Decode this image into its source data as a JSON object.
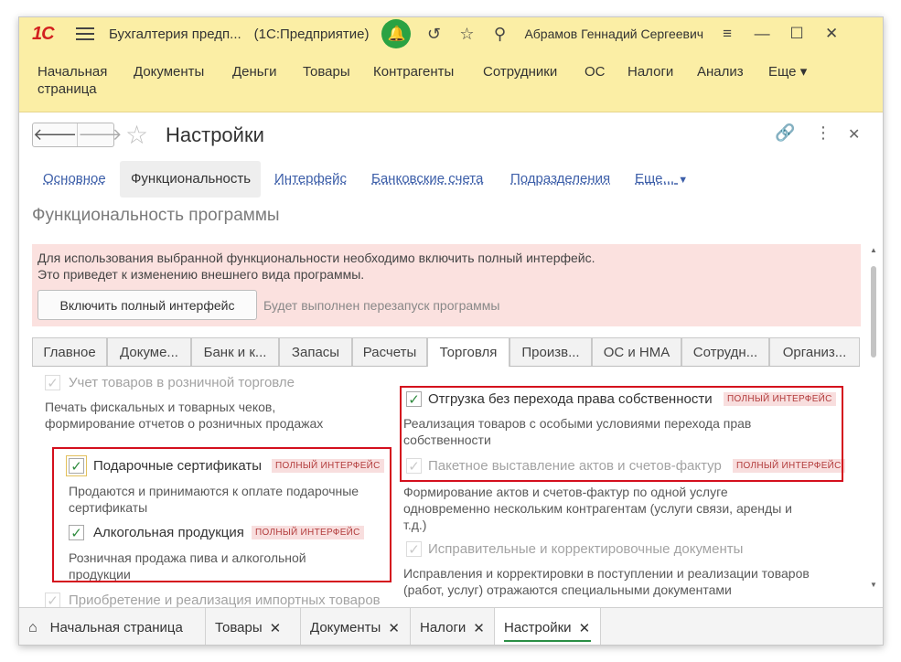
{
  "titlebar": {
    "logo": "1С",
    "app_name": "Бухгалтерия предп...",
    "platform": "(1С:Предприятие)",
    "user": "Абрамов Геннадий Сергеевич"
  },
  "menu": [
    {
      "label": "Начальная страница"
    },
    {
      "label": "Документы"
    },
    {
      "label": "Деньги"
    },
    {
      "label": "Товары"
    },
    {
      "label": "Контрагенты"
    },
    {
      "label": "Сотрудники"
    },
    {
      "label": "ОС"
    },
    {
      "label": "Налоги"
    },
    {
      "label": "Анализ"
    },
    {
      "label": "Еще ▾"
    }
  ],
  "form": {
    "title": "Настройки",
    "back": "🡐",
    "forward": "🡒"
  },
  "subtabs": [
    {
      "label": "Основное"
    },
    {
      "label": "Функциональность"
    },
    {
      "label": "Интерфейс"
    },
    {
      "label": "Банковские счета"
    },
    {
      "label": "Подразделения"
    },
    {
      "label": "Еще..."
    }
  ],
  "section_title": "Функциональность программы",
  "warning": {
    "line1": "Для использования выбранной функциональности необходимо включить полный интерфейс.",
    "line2": "Это приведет к изменению внешнего вида программы.",
    "button": "Включить полный интерфейс",
    "note": "Будет выполнен перезапуск программы"
  },
  "inner_tabs": [
    {
      "label": "Главное"
    },
    {
      "label": "Докуме..."
    },
    {
      "label": "Банк и к..."
    },
    {
      "label": "Запасы"
    },
    {
      "label": "Расчеты"
    },
    {
      "label": "Торговля"
    },
    {
      "label": "Произв..."
    },
    {
      "label": "ОС и НМА"
    },
    {
      "label": "Сотрудн..."
    },
    {
      "label": "Организ..."
    }
  ],
  "badge_text": "ПОЛНЫЙ ИНТЕРФЕЙС",
  "left_col": {
    "retail": {
      "label": "Учет товаров в розничной торговле",
      "desc1": "Печать фискальных и товарных чеков,",
      "desc2": "формирование отчетов о розничных продажах",
      "checked": true,
      "disabled": true
    },
    "gift": {
      "label": "Подарочные сертификаты",
      "desc1": "Продаются и принимаются к оплате подарочные",
      "desc2": "сертификаты",
      "checked": true
    },
    "alcohol": {
      "label": "Алкогольная продукция",
      "desc1": "Розничная продажа пива и алкогольной",
      "desc2": "продукции",
      "checked": true
    },
    "import": {
      "label": "Приобретение и реализация импортных товаров",
      "checked": true,
      "disabled": true
    }
  },
  "right_col": {
    "shipment": {
      "label": "Отгрузка без перехода права собственности",
      "desc1": "Реализация товаров с особыми условиями перехода прав",
      "desc2": "собственности",
      "checked": true
    },
    "batch": {
      "label": "Пакетное выставление актов и счетов-фактур",
      "desc1": "Формирование актов и счетов-фактур по одной услуге",
      "desc2": "одновременно нескольким контрагентам (услуги связи, аренды и",
      "desc3": "т.д.)",
      "checked": true,
      "disabled": true
    },
    "corrective": {
      "label": "Исправительные и корректировочные документы",
      "desc1": "Исправления и корректировки в поступлении и реализации товаров",
      "desc2": "(работ, услуг) отражаются специальными документами",
      "checked": true,
      "disabled": true
    }
  },
  "taskbar": [
    {
      "label": "Начальная страница"
    },
    {
      "label": "Товары"
    },
    {
      "label": "Документы"
    },
    {
      "label": "Налоги"
    },
    {
      "label": "Настройки"
    }
  ],
  "colors": {
    "titlebar_bg": "#fbeea5",
    "warning_bg": "#fbe1df",
    "highlight_border": "#d40f1d",
    "checkbox_check": "#2e8b3e",
    "link": "#3d5fa9",
    "notification": "#2aa243"
  }
}
